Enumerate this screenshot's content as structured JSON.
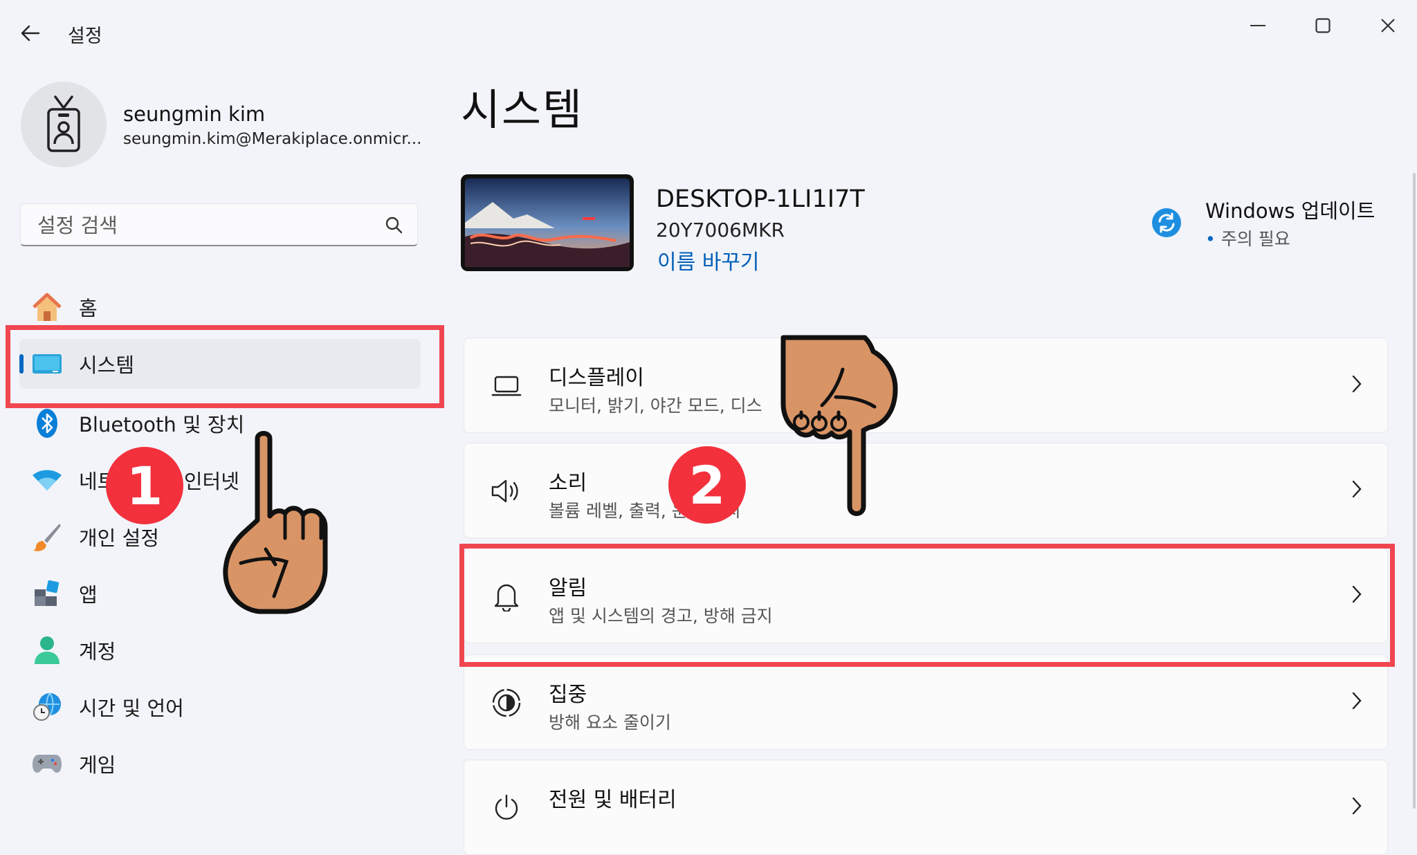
{
  "titlebar": {
    "title": "설정"
  },
  "profile": {
    "name": "seungmin kim",
    "email": "seungmin.kim@Merakiplace.onmicr..."
  },
  "search": {
    "placeholder": "설정 검색"
  },
  "sidebar": {
    "items": [
      {
        "label": "홈",
        "icon": "home-icon"
      },
      {
        "label": "시스템",
        "icon": "system-icon",
        "selected": true
      },
      {
        "label": "Bluetooth 및 장치",
        "icon": "bluetooth-icon"
      },
      {
        "label": "네트워크 및 인터넷",
        "icon": "wifi-icon"
      },
      {
        "label": "개인 설정",
        "icon": "brush-icon"
      },
      {
        "label": "앱",
        "icon": "apps-icon"
      },
      {
        "label": "계정",
        "icon": "account-icon"
      },
      {
        "label": "시간 및 언어",
        "icon": "globe-clock-icon"
      },
      {
        "label": "게임",
        "icon": "gamepad-icon"
      }
    ]
  },
  "main": {
    "title": "시스템",
    "device": {
      "name": "DESKTOP-1LI1I7T",
      "model": "20Y7006MKR",
      "rename": "이름 바꾸기"
    },
    "update": {
      "title": "Windows 업데이트",
      "status": "주의 필요"
    },
    "cards": [
      {
        "title": "디스플레이",
        "subtitle": "모니터, 밝기, 야간 모드, 디스",
        "icon": "laptop-icon"
      },
      {
        "title": "소리",
        "subtitle": "볼륨 레벨, 출력,  운드 장치",
        "icon": "speaker-icon"
      },
      {
        "title": "알림",
        "subtitle": "앱 및 시스템의 경고, 방해 금지",
        "icon": "bell-icon"
      },
      {
        "title": "집중",
        "subtitle": "방해 요소 줄이기",
        "icon": "focus-icon"
      },
      {
        "title": "전원 및 배터리",
        "subtitle": "",
        "icon": "power-icon"
      }
    ]
  },
  "annotations": {
    "step1": "1",
    "step2": "2"
  },
  "colors": {
    "accent": "#0067c0",
    "highlight": "#f04650",
    "badge": "#f2313d",
    "hand": "#d99465"
  }
}
